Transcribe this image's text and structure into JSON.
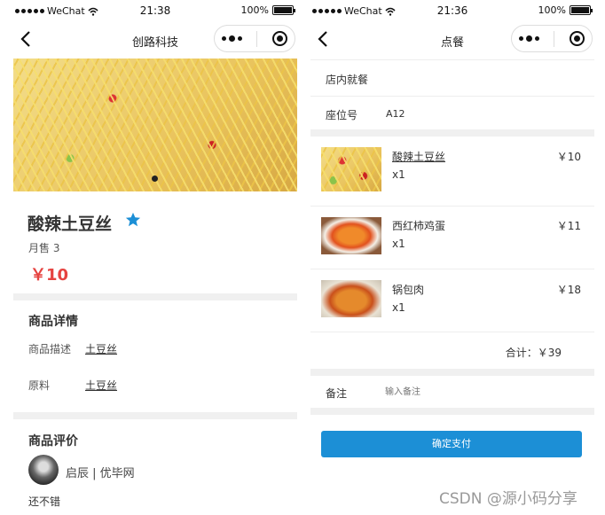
{
  "status_bar": {
    "carrier": "WeChat",
    "battery": "100%"
  },
  "left": {
    "time": "21:38",
    "nav_title": "创路科技",
    "dish": {
      "name": "酸辣土豆丝",
      "sales": "月售 3",
      "price": "￥10"
    },
    "details": {
      "section_title": "商品详情",
      "desc_label": "商品描述",
      "desc_value": "土豆丝",
      "material_label": "原料",
      "material_value": "土豆丝"
    },
    "reviews": {
      "section_title": "商品评价",
      "reviewer": "启辰 | 优毕网",
      "comment": "还不错"
    }
  },
  "right": {
    "time": "21:36",
    "nav_title": "点餐",
    "dine_mode": "店内就餐",
    "seat_label": "座位号",
    "seat_value": "A12",
    "items": [
      {
        "name": "酸辣土豆丝",
        "qty": "x1",
        "price": "￥10"
      },
      {
        "name": "西红柿鸡蛋",
        "qty": "x1",
        "price": "￥11"
      },
      {
        "name": "锅包肉",
        "qty": "x1",
        "price": "￥18"
      }
    ],
    "total": "合计：￥39",
    "note_label": "备注",
    "note_placeholder": "输入备注",
    "pay_button": "确定支付"
  },
  "watermark": "CSDN @源小码分享",
  "colors": {
    "price": "#e64340",
    "accent": "#1c8fd6",
    "star": "#1c8fd6"
  },
  "icons": [
    "back-arrow-icon",
    "more-dots-icon",
    "record-circle-icon",
    "star-icon",
    "signal-dots-icon",
    "wifi-icon",
    "battery-icon"
  ]
}
